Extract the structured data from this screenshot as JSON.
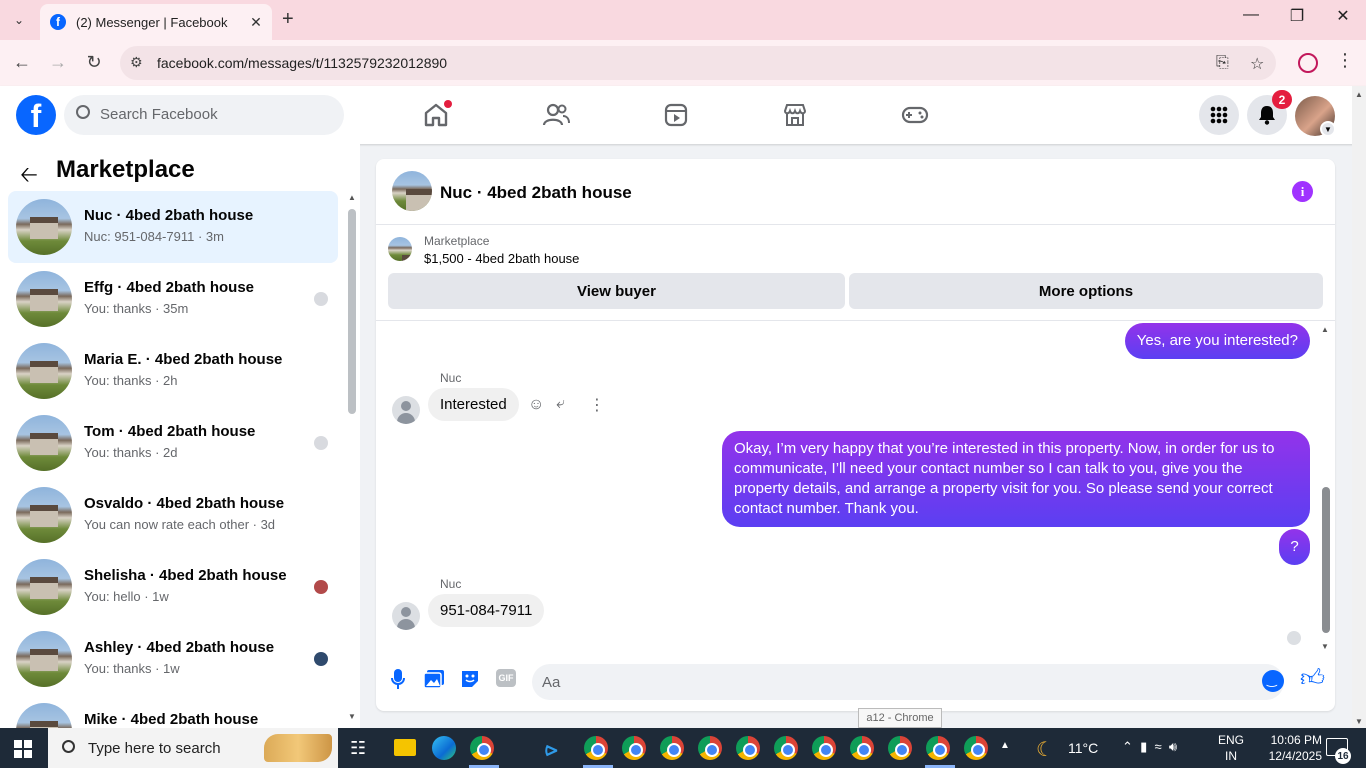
{
  "browser": {
    "tab_title": "(2) Messenger | Facebook",
    "tab_favicon": "f",
    "url": "facebook.com/messages/t/1132579232012890"
  },
  "fb_header": {
    "logo": "f",
    "search_placeholder": "Search Facebook",
    "notification_count": "2",
    "brand_color": "#0866ff"
  },
  "left_panel": {
    "title": "Marketplace",
    "conversations": [
      {
        "name": "Nuc · 4bed 2bath house",
        "sub": "Nuc: 951-084-7911 · 3m",
        "active": true
      },
      {
        "name": "Effg · 4bed 2bath house",
        "sub": "You: thanks · 35m"
      },
      {
        "name": "Maria E. · 4bed 2bath house",
        "sub": "You: thanks · 2h"
      },
      {
        "name": "Tom · 4bed 2bath house",
        "sub": "You: thanks · 2d"
      },
      {
        "name": "Osvaldo · 4bed 2bath house",
        "sub": "You can now rate each other · 3d"
      },
      {
        "name": "Shelisha · 4bed 2bath house",
        "sub": "You: hello · 1w"
      },
      {
        "name": "Ashley · 4bed 2bath house",
        "sub": "You: thanks · 1w"
      },
      {
        "name": "Mike · 4bed 2bath house",
        "sub": ""
      }
    ]
  },
  "chat": {
    "title": "Nuc · 4bed 2bath house",
    "marketplace_label": "Marketplace",
    "listing": "$1,500 - 4bed 2bath house",
    "view_buyer_label": "View buyer",
    "more_options_label": "More options",
    "messages": {
      "out1": "Yes, are you interested?",
      "sender1": "Nuc",
      "in1": "Interested",
      "out2": "Okay, I’m very happy that you’re interested in this property. Now, in order for us to communicate, I’ll need your contact number so I can talk to you, give you the property details, and arrange a property visit for you. So please send your correct contact number. Thank you.",
      "out3": "?",
      "sender2": "Nuc",
      "in2": "951-084-7911"
    },
    "composer_placeholder": "Aa",
    "gif_label": "GIF",
    "accent_color": "#a033ff"
  },
  "tooltip": "a12 - Chrome",
  "taskbar": {
    "search_placeholder": "Type here to search",
    "temperature": "11°C",
    "language": "ENG",
    "region": "IN",
    "time": "10:06 PM",
    "date": "12/4/2025",
    "notification_count": "16"
  }
}
